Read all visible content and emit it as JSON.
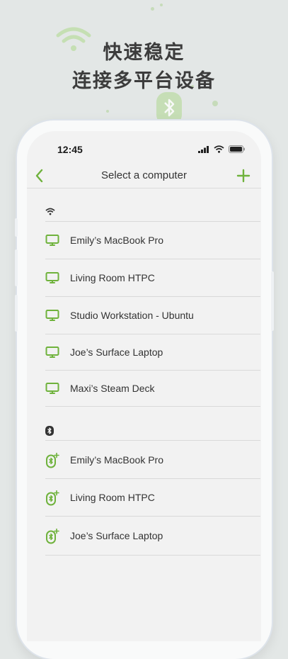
{
  "headline": {
    "line1": "快速稳定",
    "line2": "连接多平台设备"
  },
  "status_bar": {
    "time": "12:45"
  },
  "nav": {
    "title": "Select a computer",
    "back_icon": "chevron-left-icon",
    "add_icon": "plus-icon"
  },
  "colors": {
    "accent": "#6fb23c",
    "background": "#e3e7e6",
    "screen": "#f2f2f2"
  },
  "wifi_section": {
    "icon": "wifi-icon",
    "items": [
      {
        "label": "Emily’s MacBook Pro",
        "icon": "monitor-icon"
      },
      {
        "label": "Living Room HTPC",
        "icon": "monitor-icon"
      },
      {
        "label": "Studio Workstation - Ubuntu",
        "icon": "monitor-icon"
      },
      {
        "label": "Joe’s Surface Laptop",
        "icon": "monitor-icon"
      },
      {
        "label": "Maxi’s Steam Deck",
        "icon": "monitor-icon"
      }
    ]
  },
  "bluetooth_section": {
    "icon": "bluetooth-icon",
    "items": [
      {
        "label": "Emily’s MacBook Pro",
        "icon": "bluetooth-mouse-icon"
      },
      {
        "label": "Living Room HTPC",
        "icon": "bluetooth-mouse-icon"
      },
      {
        "label": "Joe’s Surface Laptop",
        "icon": "bluetooth-mouse-icon"
      }
    ]
  }
}
